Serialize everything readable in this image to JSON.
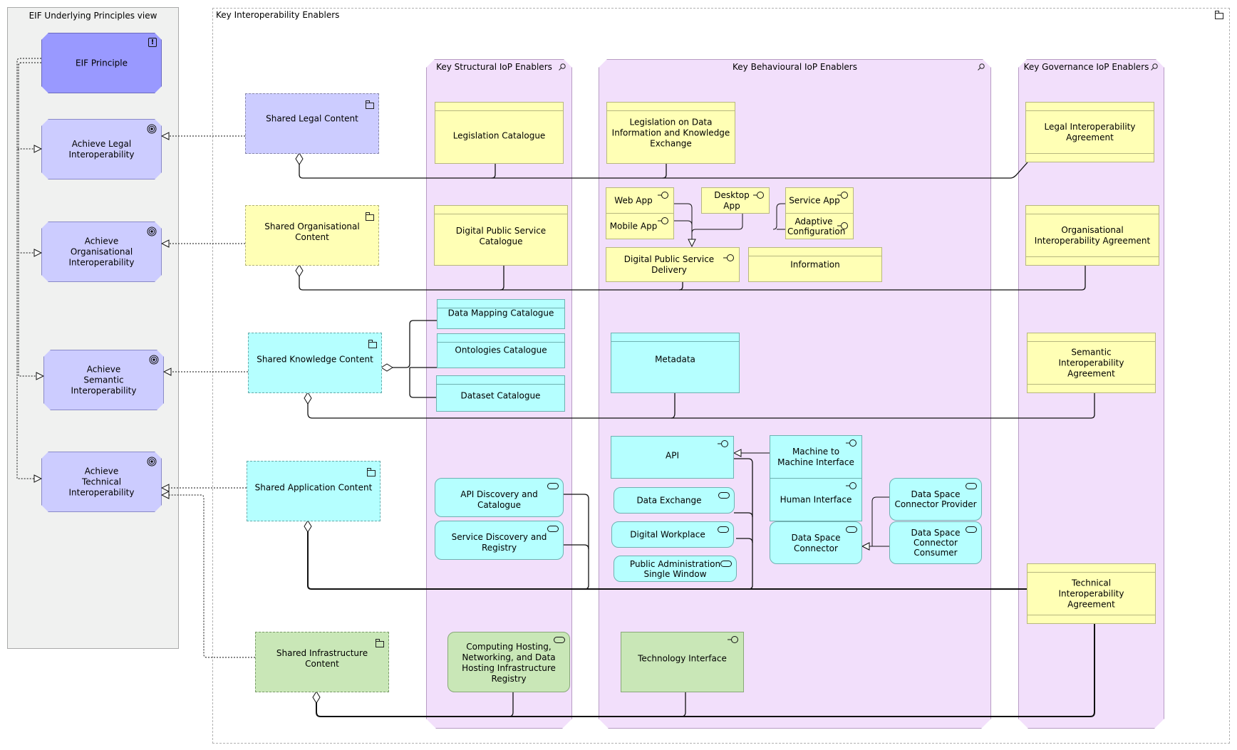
{
  "left_panel": {
    "title": "EIF Underlying Principles view",
    "principle": {
      "label": "EIF Principle",
      "icon": "exclamation-icon"
    },
    "goals": [
      {
        "label": "Achieve Legal Interoperability",
        "icon": "target-icon"
      },
      {
        "label": "Achieve Organisational Interoperability",
        "icon": "target-icon"
      },
      {
        "label": "Achieve Semantic Interoperability",
        "icon": "target-icon"
      },
      {
        "label": "Achieve Technical Interoperability",
        "icon": "target-icon"
      }
    ]
  },
  "outer": {
    "title": "Key Interoperability Enablers",
    "icon": "folder-icon"
  },
  "groups": [
    {
      "label": "Shared Legal Content",
      "icon": "folder-icon"
    },
    {
      "label": "Shared Organisational Content",
      "icon": "folder-icon"
    },
    {
      "label": "Shared Knowledge Content",
      "icon": "folder-icon"
    },
    {
      "label": "Shared Application Content",
      "icon": "folder-icon"
    },
    {
      "label": "Shared Infrastructure Content",
      "icon": "folder-icon"
    }
  ],
  "columns": {
    "structural": {
      "title": "Key Structural IoP Enablers",
      "icon": "magnifier-icon",
      "items": [
        {
          "label": "Legislation Catalogue",
          "type": "business-object"
        },
        {
          "label": "Digital Public Service Catalogue",
          "type": "business-object"
        },
        {
          "label": "Data Mapping Catalogue",
          "type": "data-object"
        },
        {
          "label": "Ontologies Catalogue",
          "type": "data-object"
        },
        {
          "label": "Dataset Catalogue",
          "type": "data-object"
        },
        {
          "label": "API Discovery and Catalogue",
          "type": "application-service"
        },
        {
          "label": "Service Discovery and Registry",
          "type": "application-service"
        },
        {
          "label": "Computing Hosting, Networking, and Data Hosting Infrastructure Registry",
          "type": "technology-service"
        }
      ]
    },
    "behavioural": {
      "title": "Key Behavioural IoP Enablers",
      "icon": "magnifier-icon",
      "items": [
        {
          "label": "Legislation on Data Information and Knowledge Exchange",
          "type": "business-object"
        },
        {
          "label": "Web App",
          "type": "business-interface"
        },
        {
          "label": "Mobile App",
          "type": "business-interface"
        },
        {
          "label": "Desktop App",
          "type": "business-interface"
        },
        {
          "label": "Service App",
          "type": "business-interface"
        },
        {
          "label": "Adaptive Configuration",
          "type": "business-interface"
        },
        {
          "label": "Digital Public Service Delivery",
          "type": "business-interface"
        },
        {
          "label": "Information",
          "type": "business-object"
        },
        {
          "label": "Metadata",
          "type": "data-object"
        },
        {
          "label": "API",
          "type": "application-interface"
        },
        {
          "label": "Machine to Machine Interface",
          "type": "application-interface"
        },
        {
          "label": "Human Interface",
          "type": "application-interface"
        },
        {
          "label": "Data Exchange",
          "type": "application-service"
        },
        {
          "label": "Digital Workplace",
          "type": "application-service"
        },
        {
          "label": "Public Administration Single Window",
          "type": "application-service"
        },
        {
          "label": "Data Space Connector",
          "type": "application-service"
        },
        {
          "label": "Data Space Connector Provider",
          "type": "application-service"
        },
        {
          "label": "Data Space Connector Consumer",
          "type": "application-service"
        },
        {
          "label": "Technology Interface",
          "type": "technology-interface"
        }
      ]
    },
    "governance": {
      "title": "Key Governance IoP Enablers",
      "icon": "magnifier-icon",
      "items": [
        {
          "label": "Legal Interoperability Agreement",
          "type": "contract"
        },
        {
          "label": "Organisational Interoperability Agreement",
          "type": "contract"
        },
        {
          "label": "Semantic Interoperability Agreement",
          "type": "contract"
        },
        {
          "label": "Technical Interoperability Agreement",
          "type": "contract"
        }
      ]
    }
  },
  "colors": {
    "principle": "#9999ff",
    "goal": "#ccccff",
    "business": "#ffffb5",
    "application": "#b5ffff",
    "technology": "#c9e7b7",
    "column": "#f2dffb",
    "left_panel": "#f0f1f0"
  }
}
